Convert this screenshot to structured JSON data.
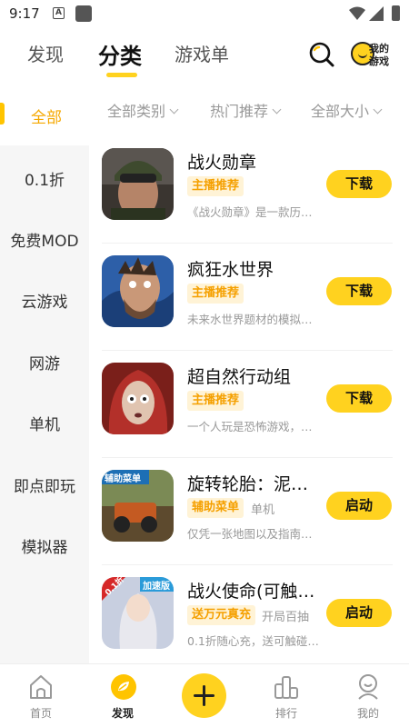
{
  "status_bar": {
    "time": "9:17",
    "a_label": "A"
  },
  "top_tabs": {
    "discover": "发现",
    "category": "分类",
    "game_list": "游戏单",
    "my_game_line1": "我的",
    "my_game_line2": "游戏"
  },
  "filters": {
    "all": "全部",
    "category": "全部类别",
    "sort": "热门推荐",
    "size": "全部大小"
  },
  "sidebar": [
    "0.1折",
    "免费MOD",
    "云游戏",
    "网游",
    "单机",
    "即点即玩",
    "模拟器"
  ],
  "games": [
    {
      "title": "战火勋章",
      "tag": "主播推荐",
      "tag2": "",
      "desc": "《战火勋章》是一款历史…",
      "action": "下载"
    },
    {
      "title": "疯狂水世界",
      "tag": "主播推荐",
      "tag2": "",
      "desc": "未来水世界题材的模拟经…",
      "action": "下载"
    },
    {
      "title": "超自然行动组",
      "tag": "主播推荐",
      "tag2": "",
      "desc": "一个人玩是恐怖游戏，两…",
      "action": "下载"
    },
    {
      "title": "旋转轮胎：泥泞…",
      "tag": "辅助菜单",
      "tag2": "单机",
      "desc": "仅凭一张地图以及指南针…",
      "action": "启动",
      "badge": "辅助菜单"
    },
    {
      "title": "战火使命(可触碰…",
      "tag": "送万元真充",
      "tag2": "开局百抽",
      "desc": "0.1折随心充，送可触碰战…",
      "action": "启动",
      "badge": "加速版",
      "badge2": "0.1折"
    }
  ],
  "bottom_nav": {
    "home": "首页",
    "discover": "发现",
    "rank": "排行",
    "mine": "我的"
  },
  "colors": {
    "accent": "#ffd21f",
    "accent_text": "#f5a800"
  }
}
